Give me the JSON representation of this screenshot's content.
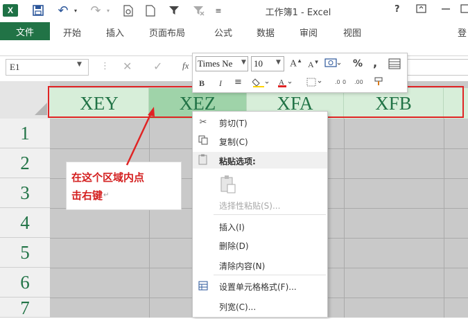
{
  "titlebar": {
    "title": "工作簿1 - Excel",
    "logo": "X",
    "help": "?",
    "icons": [
      "excel-logo",
      "save-icon",
      "undo-icon",
      "redo-icon",
      "print-preview-icon",
      "new-doc-icon",
      "filter-icon",
      "clear-filter-icon",
      "customize-qat-icon"
    ]
  },
  "ribbon": {
    "tabs": [
      "文件",
      "开始",
      "插入",
      "页面布局",
      "公式",
      "数据",
      "审阅",
      "视图",
      "登"
    ]
  },
  "formula_bar": {
    "name_box": "E1",
    "fx": "fx"
  },
  "sheet": {
    "columns": [
      "XEY",
      "XEZ",
      "XFA",
      "XFB"
    ],
    "rows": [
      "1",
      "2",
      "3",
      "4",
      "5",
      "6",
      "7"
    ]
  },
  "mini_toolbar": {
    "font_name": "Times Ne",
    "font_size": "10",
    "percent": "%",
    "comma": ","
  },
  "context_menu": {
    "items": [
      {
        "label": "剪切(T)",
        "disabled": false
      },
      {
        "label": "复制(C)",
        "disabled": false
      },
      {
        "label": "粘贴选项:",
        "disabled": false
      },
      {
        "label": "选择性粘贴(S)...",
        "disabled": true
      },
      {
        "label": "插入(I)",
        "disabled": false
      },
      {
        "label": "删除(D)",
        "disabled": false
      },
      {
        "label": "清除内容(N)",
        "disabled": false
      },
      {
        "label": "设置单元格格式(F)...",
        "disabled": false
      },
      {
        "label": "列宽(C)...",
        "disabled": false
      }
    ]
  },
  "annotation": {
    "line1": "在这个区域内点",
    "line2": "击右键",
    "color": "#d42020"
  },
  "colors": {
    "excel_green": "#217346",
    "header_highlight": "#d7eed9",
    "selected_header": "#9fd3a9",
    "annotation_red": "#e02424"
  }
}
